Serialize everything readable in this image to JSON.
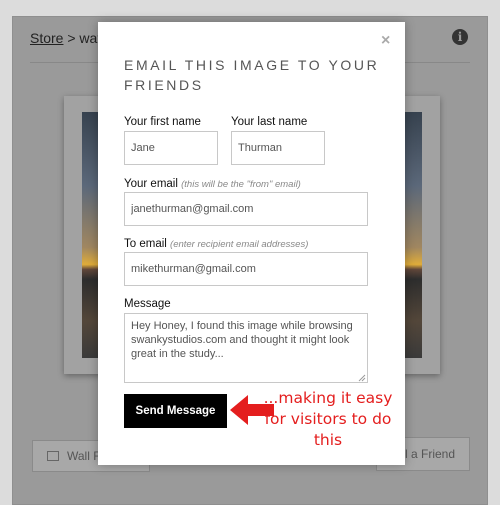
{
  "background": {
    "breadcrumb_link": "Store",
    "breadcrumb_rest": " > wats",
    "info_icon": "info-icon",
    "left_button_label": "Wall F",
    "right_button_label": "il a Friend"
  },
  "modal": {
    "title": "EMAIL THIS IMAGE TO YOUR FRIENDS",
    "close_symbol": "×",
    "first_name": {
      "label": "Your first name",
      "value": "Jane"
    },
    "last_name": {
      "label": "Your last name",
      "value": "Thurman"
    },
    "your_email": {
      "label": "Your email",
      "hint": "(this will be the \"from\" email)",
      "value": "janethurman@gmail.com"
    },
    "to_email": {
      "label": "To email",
      "hint": "(enter recipient email addresses)",
      "value": "mikethurman@gmail.com"
    },
    "message": {
      "label": "Message",
      "value": "Hey Honey, I found this image while browsing swankystudios.com and thought it might look great in the study..."
    },
    "send_label": "Send Message"
  },
  "annotation": {
    "text": "...making it easy for visitors to do this",
    "color": "#e41e1e"
  }
}
